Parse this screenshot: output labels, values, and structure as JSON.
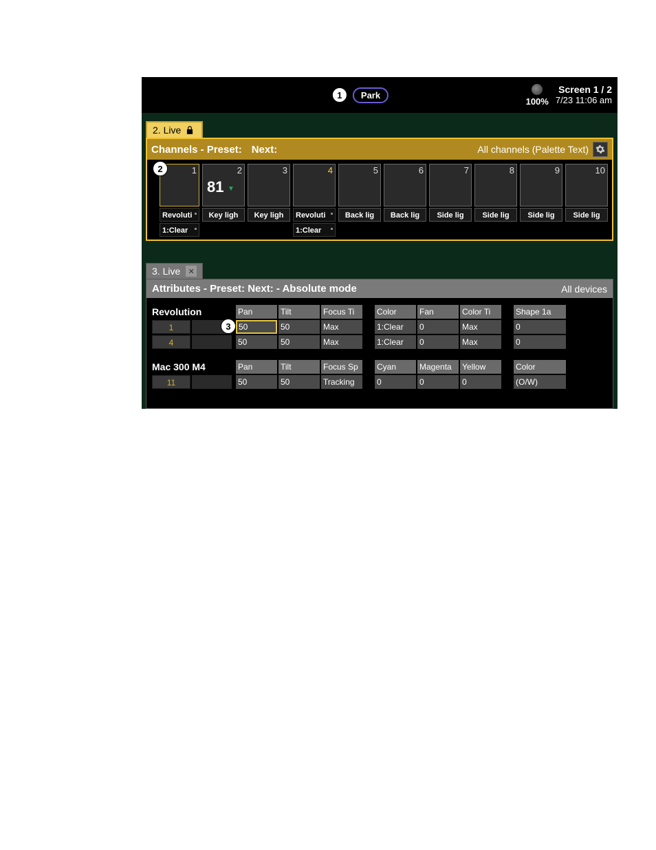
{
  "topbar": {
    "park_label": "Park",
    "intensity_pct": "100%",
    "screen": "Screen 1 / 2",
    "clock": "7/23 11:06 am"
  },
  "callouts": {
    "c1": "1",
    "c2": "2",
    "c3": "3"
  },
  "panel2": {
    "tab_label": "2. Live",
    "header_title": "Channels - Preset:",
    "header_next": "Next:",
    "header_right": "All channels (Palette Text)",
    "channels": [
      {
        "num": "1",
        "sub": "",
        "value": "",
        "extras": [
          "Revoluti",
          "1:Clear"
        ]
      },
      {
        "num": "2",
        "sub": "Key ligh",
        "value": "81"
      },
      {
        "num": "3",
        "sub": "Key ligh"
      },
      {
        "num": "4",
        "sub": "",
        "extras": [
          "Revoluti",
          "1:Clear"
        ],
        "gold": true
      },
      {
        "num": "5",
        "sub": "Back lig"
      },
      {
        "num": "6",
        "sub": "Back lig"
      },
      {
        "num": "7",
        "sub": "Side lig"
      },
      {
        "num": "8",
        "sub": "Side lig"
      },
      {
        "num": "9",
        "sub": "Side lig"
      },
      {
        "num": "10",
        "sub": "Side lig"
      }
    ]
  },
  "panel3": {
    "tab_label": "3. Live",
    "header_title": "Attributes - Preset:  Next:  - Absolute mode",
    "header_right": "All devices",
    "fixtures": [
      {
        "name": "Revolution",
        "headers_a": [
          "Pan",
          "Tilt",
          "Focus Ti"
        ],
        "headers_b": [
          "Color",
          "Fan",
          "Color Ti"
        ],
        "headers_c": [
          "Shape 1a"
        ],
        "rows": [
          {
            "id": "1",
            "a": [
              "50",
              "50",
              "Max"
            ],
            "b": [
              "1:Clear",
              "0",
              "Max"
            ],
            "c": [
              "0"
            ],
            "sel": 0
          },
          {
            "id": "4",
            "a": [
              "50",
              "50",
              "Max"
            ],
            "b": [
              "1:Clear",
              "0",
              "Max"
            ],
            "c": [
              "0"
            ]
          }
        ]
      },
      {
        "name": "Mac 300 M4",
        "headers_a": [
          "Pan",
          "Tilt",
          "Focus Sp"
        ],
        "headers_b": [
          "Cyan",
          "Magenta",
          "Yellow"
        ],
        "headers_c": [
          "Color"
        ],
        "rows": [
          {
            "id": "11",
            "a": [
              "50",
              "50",
              "Tracking"
            ],
            "b": [
              "0",
              "0",
              "0"
            ],
            "c": [
              "(O/W)"
            ]
          }
        ]
      }
    ]
  }
}
